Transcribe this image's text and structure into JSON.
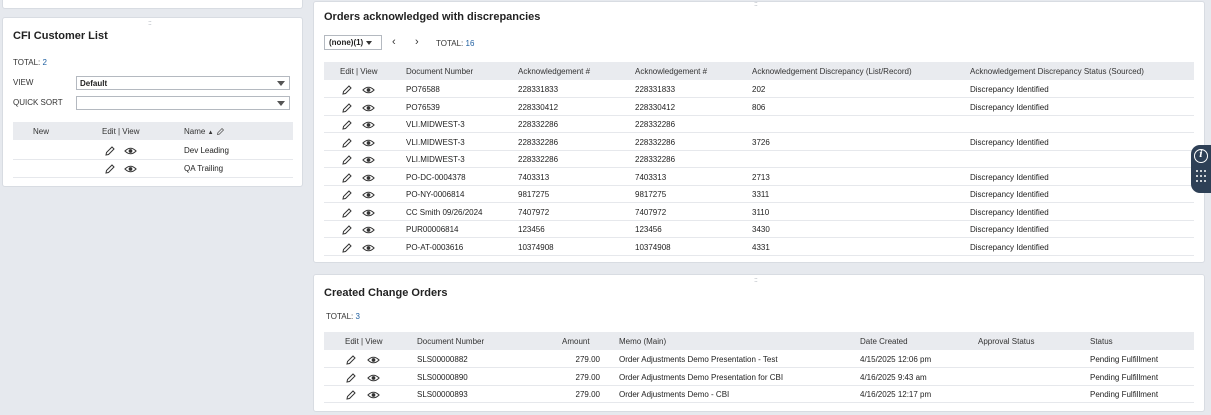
{
  "customer_list": {
    "title": "CFI Customer List",
    "total_label": "TOTAL:",
    "total_value": "2",
    "view_label": "VIEW",
    "view_value": "Default",
    "quick_sort_label": "QUICK SORT",
    "quick_sort_value": "",
    "columns": {
      "new": "New",
      "edit_view": "Edit | View",
      "name": "Name"
    },
    "rows": [
      {
        "name": "Dev Leading"
      },
      {
        "name": "QA Trailing"
      }
    ]
  },
  "orders_ack": {
    "title": "Orders acknowledged with discrepancies",
    "filter_value": "(none)(1)",
    "total_label": "TOTAL:",
    "total_value": "16",
    "columns": {
      "edit_view": "Edit | View",
      "doc": "Document Number",
      "ack1": "Acknowledgement #",
      "ack2": "Acknowledgement #",
      "disc": "Acknowledgement Discrepancy (List/Record)",
      "status": "Acknowledgement Discrepancy Status (Sourced)"
    },
    "rows": [
      {
        "doc": "PO76588",
        "ack1": "228331833",
        "ack2": "228331833",
        "disc": "202",
        "status": "Discrepancy Identified"
      },
      {
        "doc": "PO76539",
        "ack1": "228330412",
        "ack2": "228330412",
        "disc": "806",
        "status": "Discrepancy Identified"
      },
      {
        "doc": "VLI.MIDWEST-3",
        "ack1": "228332286",
        "ack2": "228332286",
        "disc": "",
        "status": ""
      },
      {
        "doc": "VLI.MIDWEST-3",
        "ack1": "228332286",
        "ack2": "228332286",
        "disc": "3726",
        "status": "Discrepancy Identified"
      },
      {
        "doc": "VLI.MIDWEST-3",
        "ack1": "228332286",
        "ack2": "228332286",
        "disc": "",
        "status": ""
      },
      {
        "doc": "PO-DC-0004378",
        "ack1": "7403313",
        "ack2": "7403313",
        "disc": "2713",
        "status": "Discrepancy Identified"
      },
      {
        "doc": "PO-NY-0006814",
        "ack1": "9817275",
        "ack2": "9817275",
        "disc": "3311",
        "status": "Discrepancy Identified"
      },
      {
        "doc": "CC Smith 09/26/2024",
        "ack1": "7407972",
        "ack2": "7407972",
        "disc": "3110",
        "status": "Discrepancy Identified"
      },
      {
        "doc": "PUR00006814",
        "ack1": "123456",
        "ack2": "123456",
        "disc": "3430",
        "status": "Discrepancy Identified"
      },
      {
        "doc": "PO-AT-0003616",
        "ack1": "10374908",
        "ack2": "10374908",
        "disc": "4331",
        "status": "Discrepancy Identified"
      }
    ]
  },
  "change_orders": {
    "title": "Created Change Orders",
    "total_label": "TOTAL:",
    "total_value": "3",
    "columns": {
      "edit_view": "Edit | View",
      "doc": "Document Number",
      "amount": "Amount",
      "memo": "Memo (Main)",
      "date": "Date Created",
      "approval": "Approval Status",
      "status": "Status"
    },
    "rows": [
      {
        "doc": "SLS00000882",
        "amount": "279.00",
        "memo": "Order Adjustments Demo Presentation - Test",
        "date": "4/15/2025 12:06 pm",
        "approval": "",
        "status": "Pending Fulfillment"
      },
      {
        "doc": "SLS00000890",
        "amount": "279.00",
        "memo": "Order Adjustments Demo Presentation for CBI",
        "date": "4/16/2025 9:43 am",
        "approval": "",
        "status": "Pending Fulfillment"
      },
      {
        "doc": "SLS00000893",
        "amount": "279.00",
        "memo": "Order Adjustments Demo - CBI",
        "date": "4/16/2025 12:17 pm",
        "approval": "",
        "status": "Pending Fulfillment"
      }
    ]
  },
  "side_panel": {
    "info_icon": "info-icon",
    "grid_icon": "grid-icon"
  },
  "colors": {
    "link": "#1f5fa0",
    "header_bg": "#e9ebef",
    "side_panel": "#2e4056"
  }
}
